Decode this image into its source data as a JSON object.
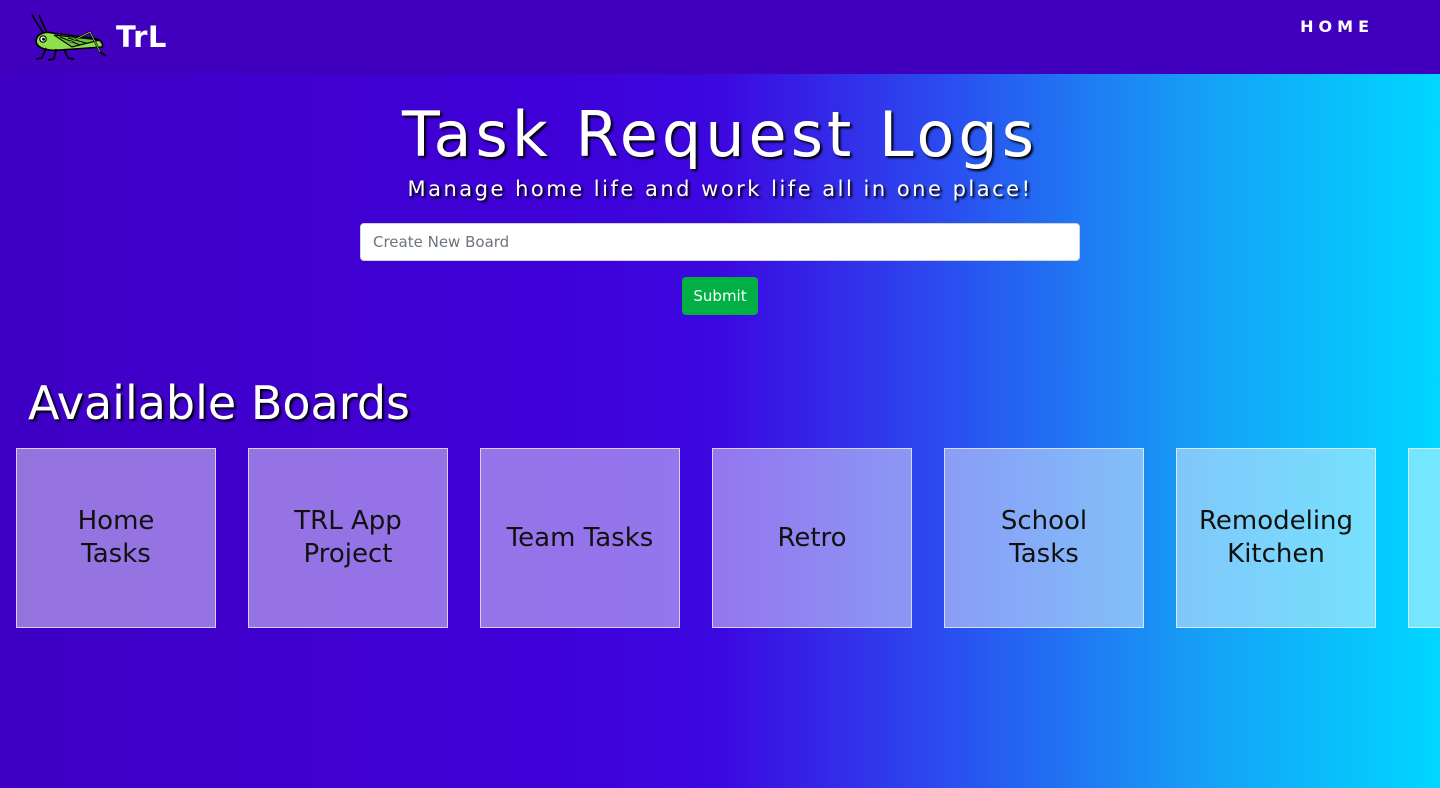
{
  "navbar": {
    "brand_text": "TrL",
    "home_link": "HOME"
  },
  "hero": {
    "title": "Task Request Logs",
    "subtitle": "Manage home life and work life all in one place!"
  },
  "form": {
    "placeholder": "Create New Board",
    "submit_label": "Submit"
  },
  "boards_section": {
    "heading": "Available Boards",
    "boards": [
      {
        "label": "Home Tasks"
      },
      {
        "label": "TRL App Project"
      },
      {
        "label": "Team Tasks"
      },
      {
        "label": "Retro"
      },
      {
        "label": "School Tasks"
      },
      {
        "label": "Remodeling Kitchen"
      },
      {
        "label": ""
      }
    ]
  },
  "colors": {
    "navbar_bg": "#4100bd",
    "gradient_start": "#3f00c4",
    "gradient_end": "#00d7ff",
    "submit_bg": "#00b044",
    "logo_green": "#8ee04a"
  },
  "icons": {
    "logo": "grasshopper-logo-icon"
  }
}
